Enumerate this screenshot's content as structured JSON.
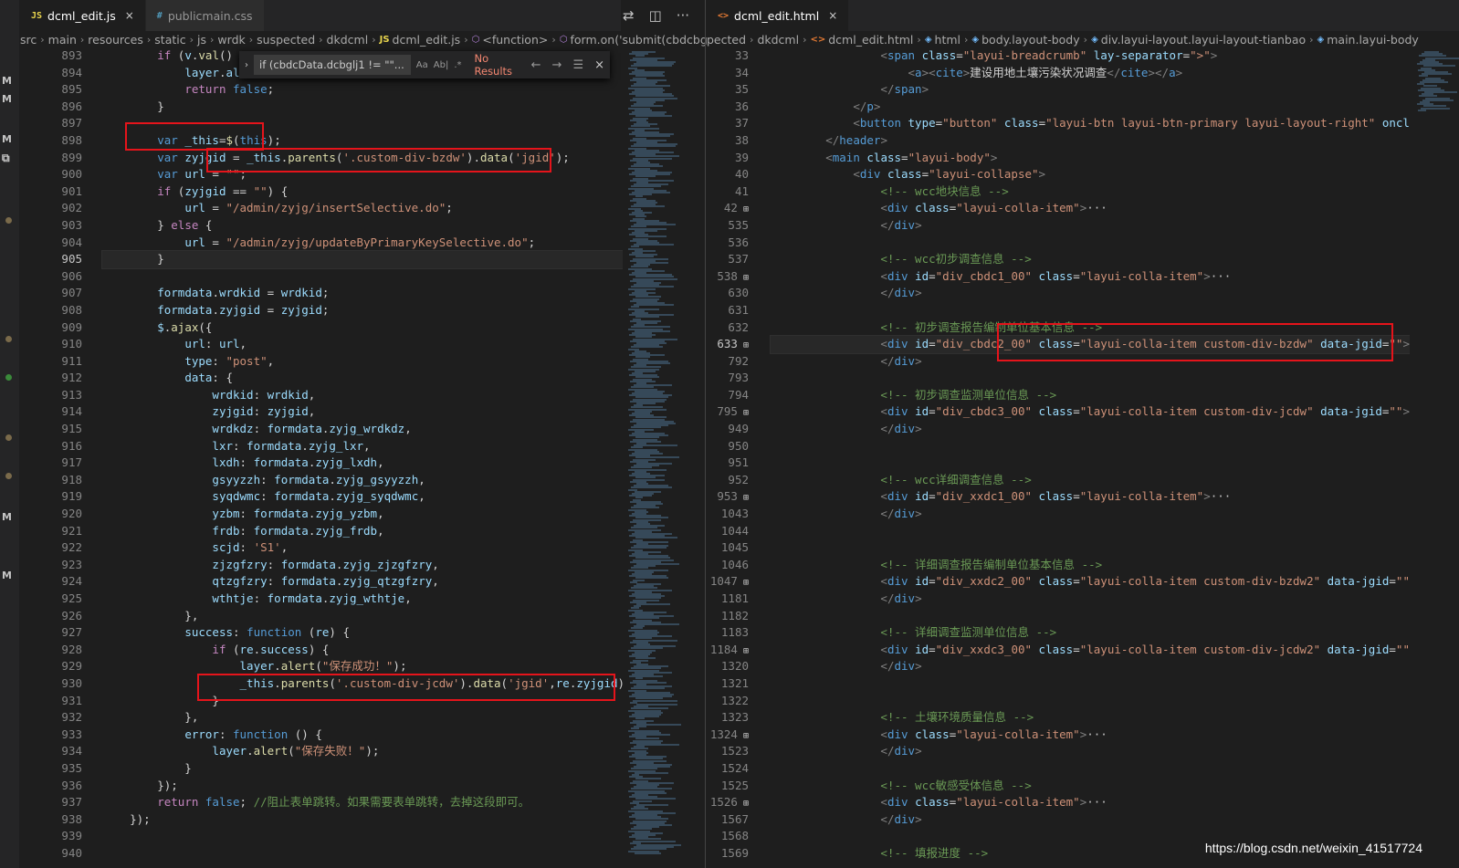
{
  "left_tabs": [
    {
      "icon": "JS",
      "label": "dcml_edit.js",
      "close": "×"
    },
    {
      "icon": "#",
      "label": "publicmain.css"
    }
  ],
  "tab_actions": [
    "⇄",
    "◫",
    "···"
  ],
  "right_tabs": [
    {
      "icon": "<>",
      "label": "dcml_edit.html",
      "close": "×"
    }
  ],
  "left_breadcrumb": [
    "src",
    "main",
    "resources",
    "static",
    "js",
    "wrdk",
    "suspected",
    "dkdcml",
    "dcml_edit.js",
    "<function>",
    "form.on('submit(cbdcbgl"
  ],
  "right_breadcrumb": [
    "pected",
    "dkdcml",
    "dcml_edit.html",
    "html",
    "body.layout-body",
    "div.layui-layout.layui-layout-tianbao",
    "main.layui-body"
  ],
  "find": {
    "query": "if (cbdcData.dcbglj1 != \"\"...",
    "opt1": "Aa",
    "opt2": "Ab|",
    "opt3": ".*",
    "result": "No Results",
    "prev": "←",
    "next": "→",
    "menu": "☰",
    "close": "×"
  },
  "left_code": {
    "line_numbers": [
      "893",
      "894",
      "895",
      "896",
      "897",
      "898",
      "899",
      "900",
      "901",
      "902",
      "903",
      "904",
      "905",
      "906",
      "907",
      "908",
      "909",
      "910",
      "911",
      "912",
      "913",
      "914",
      "915",
      "916",
      "917",
      "918",
      "919",
      "920",
      "921",
      "922",
      "923",
      "924",
      "925",
      "926",
      "927",
      "928",
      "929",
      "930",
      "931",
      "932",
      "933",
      "934",
      "935",
      "936",
      "937",
      "938",
      "939",
      "940"
    ],
    "current": "905",
    "lines": [
      "        if (v.val() == ",
      "            layer.alert",
      "            return false;",
      "        }",
      "",
      "        var _this=$(this);",
      "        var zyjgid = _this.parents('.custom-div-bzdw').data('jgid');",
      "        var url = \"\";",
      "        if (zyjgid == \"\") {",
      "            url = \"/admin/zyjg/insertSelective.do\";",
      "        } else {",
      "            url = \"/admin/zyjg/updateByPrimaryKeySelective.do\";",
      "        }",
      "",
      "        formdata.wrdkid = wrdkid;",
      "        formdata.zyjgid = zyjgid;",
      "        $.ajax({",
      "            url: url,",
      "            type: \"post\",",
      "            data: {",
      "                wrdkid: wrdkid,",
      "                zyjgid: zyjgid,",
      "                wrdkdz: formdata.zyjg_wrdkdz,",
      "                lxr: formdata.zyjg_lxr,",
      "                lxdh: formdata.zyjg_lxdh,",
      "                gsyyzzh: formdata.zyjg_gsyyzzh,",
      "                syqdwmc: formdata.zyjg_syqdwmc,",
      "                yzbm: formdata.zyjg_yzbm,",
      "                frdb: formdata.zyjg_frdb,",
      "                scjd: 'S1',",
      "                zjzgfzry: formdata.zyjg_zjzgfzry,",
      "                qtzgfzry: formdata.zyjg_qtzgfzry,",
      "                wthtje: formdata.zyjg_wthtje,",
      "            },",
      "            success: function (re) {",
      "                if (re.success) {",
      "                    layer.alert(\"保存成功！\");",
      "                    _this.parents('.custom-div-jcdw').data('jgid',re.zyjgid);",
      "                }",
      "            },",
      "            error: function () {",
      "                layer.alert(\"保存失败！\");",
      "            }",
      "        });",
      "        return false; //阻止表单跳转。如果需要表单跳转，去掉这段即可。",
      "    });",
      "",
      ""
    ]
  },
  "right_code": {
    "line_numbers": [
      "33",
      "34",
      "35",
      "36",
      "37",
      "38",
      "39",
      "40",
      "41",
      "42",
      "535",
      "536",
      "537",
      "538",
      "630",
      "631",
      "632",
      "633",
      "792",
      "793",
      "794",
      "795",
      "949",
      "950",
      "951",
      "952",
      "953",
      "1043",
      "1044",
      "1045",
      "1046",
      "1047",
      "1181",
      "1182",
      "1183",
      "1184",
      "1320",
      "1321",
      "1322",
      "1323",
      "1324",
      "1523",
      "1524",
      "1525",
      "1526",
      "1567",
      "1568",
      "1569"
    ],
    "current": "633",
    "lines": [
      "                <span class=\"layui-breadcrumb\" lay-separator=\">\">",
      "                    <a><cite>建设用地土壤污染状况调查</cite></a>",
      "                </span>",
      "            </p>",
      "            <button type=\"button\" class=\"layui-btn layui-btn-primary layui-layout-right\" onclick=\"",
      "        </header>",
      "        <main class=\"layui-body\">",
      "            <div class=\"layui-collapse\">",
      "                <!-- wcc地块信息 -->",
      "                <div class=\"layui-colla-item\">···",
      "                </div>",
      "",
      "                <!-- wcc初步调查信息 -->",
      "                <div id=\"div_cbdc1_00\" class=\"layui-colla-item\">···",
      "                </div>",
      "",
      "                <!-- 初步调查报告编制单位基本信息 -->",
      "                <div id=\"div_cbdc2_00\" class=\"layui-colla-item custom-div-bzdw\" data-jgid=\"\">···",
      "                </div>",
      "",
      "                <!-- 初步调查监测单位信息 -->",
      "                <div id=\"div_cbdc3_00\" class=\"layui-colla-item custom-div-jcdw\" data-jgid=\"\">···",
      "                </div>",
      "",
      "",
      "                <!-- wcc详细调查信息 -->",
      "                <div id=\"div_xxdc1_00\" class=\"layui-colla-item\">···",
      "                </div>",
      "",
      "",
      "                <!-- 详细调查报告编制单位基本信息 -->",
      "                <div id=\"div_xxdc2_00\" class=\"layui-colla-item custom-div-bzdw2\" data-jgid=\"\">···",
      "                </div>",
      "",
      "                <!-- 详细调查监测单位信息 -->",
      "                <div id=\"div_xxdc3_00\" class=\"layui-colla-item custom-div-jcdw2\" data-jgid=\"\">···",
      "                </div>",
      "",
      "",
      "                <!-- 土壤环境质量信息 -->",
      "                <div class=\"layui-colla-item\">···",
      "                </div>",
      "",
      "                <!-- wcc敏感受体信息 -->",
      "                <div class=\"layui-colla-item\">···",
      "                </div>",
      "",
      "                <!-- 填报进度 -->"
    ]
  },
  "scm_markers": [
    "M",
    "M",
    "M",
    "M",
    "M"
  ],
  "watermark": "https://blog.csdn.net/weixin_41517724",
  "colors": {
    "highlight_box": "#e5141b",
    "editor_bg": "#1e1e1e",
    "keyword": "#569cd6",
    "string": "#ce9178",
    "comment": "#6a9955"
  }
}
